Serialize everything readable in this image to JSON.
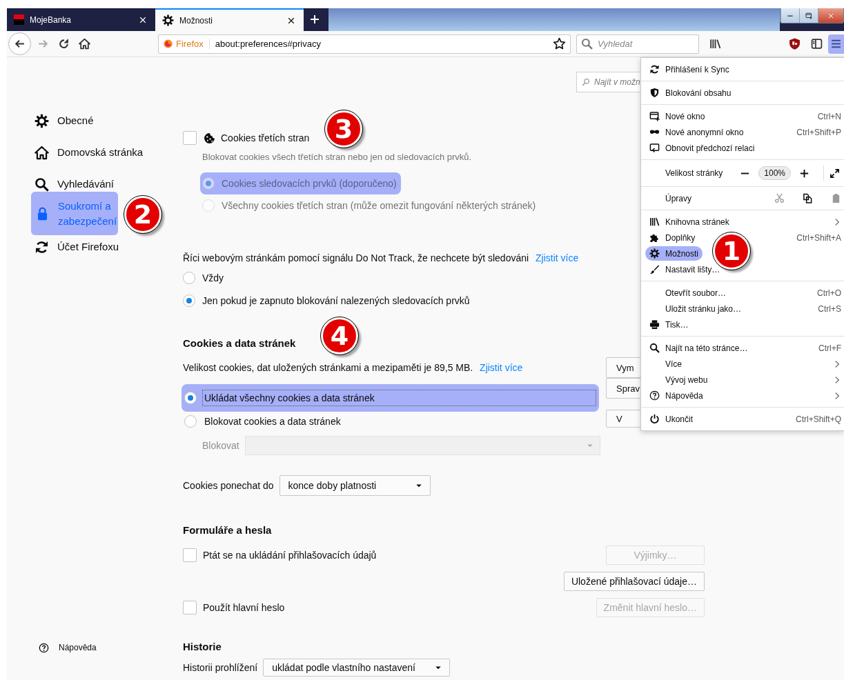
{
  "tabs": [
    {
      "title": "MojeBanka",
      "selected": false
    },
    {
      "title": "Možnosti",
      "selected": true
    }
  ],
  "toolbar": {
    "identity": "Firefox",
    "url": "about:preferences#privacy",
    "search_placeholder": "Vyhledat",
    "menu_open": true
  },
  "find_field": {
    "placeholder": "Najít v možn"
  },
  "sidebar": {
    "items": [
      {
        "label": "Obecné",
        "selected": false
      },
      {
        "label": "Domovská stránka",
        "selected": false
      },
      {
        "label": "Vyhledávání",
        "selected": false
      },
      {
        "label": "Soukromí a zabezpečení",
        "selected": true
      },
      {
        "label": "Účet Firefoxu",
        "selected": false
      }
    ],
    "help": "Nápověda"
  },
  "third_party_cookies": {
    "label": "Cookies třetích stran",
    "checked": false,
    "description": "Blokovat cookies všech třetích stran nebo jen od sledovacích prvků.",
    "options": [
      {
        "label": "Cookies sledovacích prvků (doporučeno)",
        "selected": true,
        "highlighted": true
      },
      {
        "label": "Všechny cookies třetích stran (může omezit fungování některých stránek)",
        "selected": false,
        "highlighted": false
      }
    ]
  },
  "do_not_track": {
    "text": "Říci webovým stránkám pomocí signálu Do Not Track, že nechcete být sledováni",
    "link": "Zjistit více",
    "options": [
      {
        "label": "Vždy",
        "selected": false
      },
      {
        "label": "Jen pokud je zapnuto blokování nalezených sledovacích prvků",
        "selected": true
      }
    ]
  },
  "cookies_data": {
    "heading": "Cookies a data stránek",
    "size_text": "Velikost cookies, dat uložených stránkami a mezipaměti je 89,5 MB.",
    "link": "Zjistit více",
    "buttons": [
      "Vym",
      "Sprav",
      "V"
    ],
    "options": [
      {
        "label": "Ukládat všechny cookies a data stránek",
        "selected": true,
        "highlighted": true
      },
      {
        "label": "Blokovat cookies a data stránek",
        "selected": false,
        "highlighted": false
      }
    ],
    "block_label": "Blokovat",
    "keep_label": "Cookies ponechat do",
    "keep_value": "konce doby platnosti"
  },
  "forms": {
    "heading": "Formuláře a hesla",
    "rows": [
      {
        "label": "Ptát se na ukládání přihlašovacích údajů",
        "checked": false,
        "buttons": [
          {
            "label": "Výjimky…",
            "disabled": true
          },
          {
            "label": "Uložené přihlašovací údaje…",
            "disabled": false
          }
        ]
      },
      {
        "label": "Použít hlavní heslo",
        "checked": false,
        "buttons": [
          {
            "label": "Změnit hlavní heslo…",
            "disabled": true
          }
        ]
      }
    ]
  },
  "history": {
    "heading": "Historie",
    "label": "Historii prohlížení",
    "value": "ukládat podle vlastního nastavení"
  },
  "menu": {
    "groups": [
      {
        "items": [
          {
            "kind": "item",
            "label": "Přihlášení k Sync",
            "submenu": false,
            "highlighted": false
          }
        ]
      },
      {
        "items": [
          {
            "kind": "item",
            "label": "Blokování obsahu",
            "submenu": false,
            "highlighted": false
          }
        ]
      },
      {
        "items": [
          {
            "kind": "item",
            "label": "Nové okno",
            "shortcut": "Ctrl+N",
            "submenu": false,
            "highlighted": false
          },
          {
            "kind": "item",
            "label": "Nové anonymní okno",
            "shortcut": "Ctrl+Shift+P",
            "submenu": false,
            "highlighted": false
          },
          {
            "kind": "item",
            "label": "Obnovit předchozí relaci",
            "submenu": false,
            "highlighted": false
          }
        ]
      },
      {
        "items": [
          {
            "kind": "zoom",
            "label": "Velikost stránky",
            "value": "100%"
          }
        ]
      },
      {
        "items": [
          {
            "kind": "edit",
            "label": "Úpravy",
            "actions": [
              {
                "enabled": false
              },
              {
                "enabled": true
              },
              {
                "enabled": false
              }
            ]
          }
        ]
      },
      {
        "items": [
          {
            "kind": "item",
            "label": "Knihovna stránek",
            "submenu": true,
            "highlighted": false
          },
          {
            "kind": "item",
            "label": "Doplňky",
            "shortcut": "Ctrl+Shift+A",
            "submenu": false,
            "highlighted": false
          },
          {
            "kind": "item",
            "label": "Možnosti",
            "submenu": false,
            "highlighted": true
          },
          {
            "kind": "item",
            "label": "Nastavit lišty…",
            "submenu": false,
            "highlighted": false
          }
        ]
      },
      {
        "items": [
          {
            "kind": "item",
            "label": "Otevřít soubor…",
            "shortcut": "Ctrl+O",
            "submenu": false,
            "highlighted": false
          },
          {
            "kind": "item",
            "label": "Uložit stránku jako…",
            "shortcut": "Ctrl+S",
            "submenu": false,
            "highlighted": false
          },
          {
            "kind": "item",
            "label": "Tisk…",
            "submenu": false,
            "highlighted": false
          }
        ]
      },
      {
        "items": [
          {
            "kind": "item",
            "label": "Najít na této stránce…",
            "shortcut": "Ctrl+F",
            "submenu": false,
            "highlighted": false
          },
          {
            "kind": "item",
            "label": "Více",
            "submenu": true,
            "highlighted": false
          },
          {
            "kind": "item",
            "label": "Vývoj webu",
            "submenu": true,
            "highlighted": false
          },
          {
            "kind": "item",
            "label": "Nápověda",
            "submenu": true,
            "highlighted": false
          }
        ]
      },
      {
        "items": [
          {
            "kind": "item",
            "label": "Ukončit",
            "shortcut": "Ctrl+Shift+Q",
            "submenu": false,
            "highlighted": false
          }
        ]
      }
    ]
  },
  "annotations": [
    {
      "number": "1"
    },
    {
      "number": "2"
    },
    {
      "number": "3"
    },
    {
      "number": "4"
    }
  ]
}
